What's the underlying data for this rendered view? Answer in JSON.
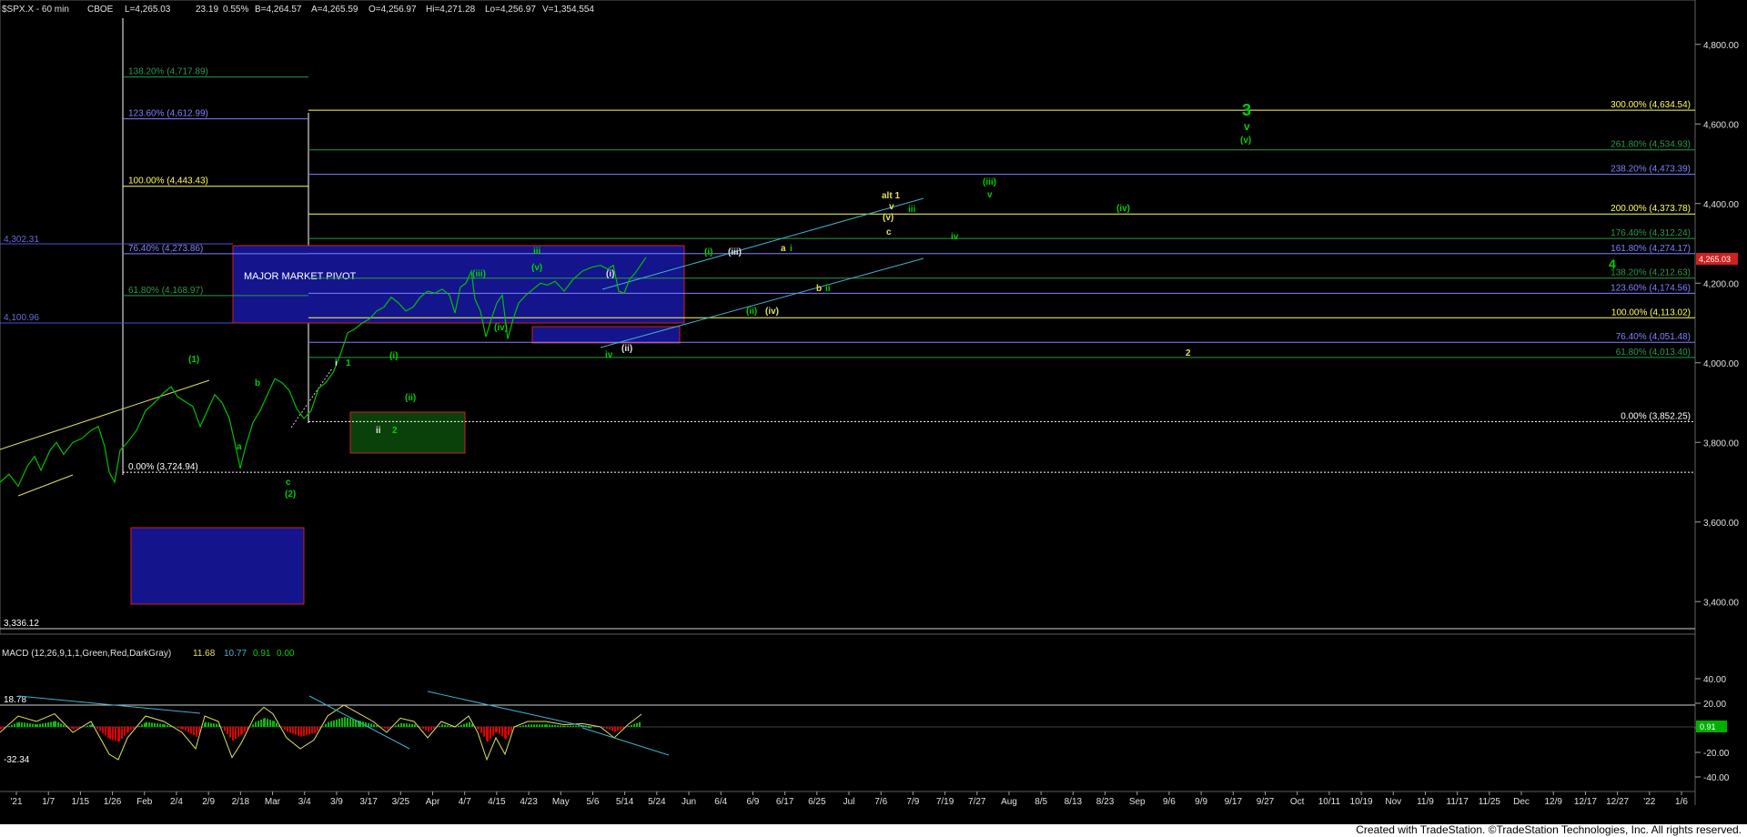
{
  "header": {
    "symbol": "$SPX.X - 60 min",
    "exchange": "CBOE",
    "last": "L=4,265.03",
    "change": "23.19",
    "change_pct": "0.55%",
    "bid": "B=4,264.57",
    "ask": "A=4,265.59",
    "open": "O=4,256.97",
    "high": "Hi=4,271.28",
    "low": "Lo=4,256.97",
    "volume": "V=1,354,554"
  },
  "left_labels": {
    "top_level": "4,302.31",
    "mid_level": "4,100.96",
    "bottom_level": "3,336.12"
  },
  "price_flag": "4,265.03",
  "pivot_label": "MAJOR MARKET PIVOT",
  "footer": "Created with TradeStation. ©TradeStation Technologies, Inc. All rights reserved.",
  "macd": {
    "title": "MACD (12,26,9,1,1,Green,Red,DarkGray)",
    "v1": "11.68",
    "v2": "10.77",
    "v3": "0.91",
    "v4": "0.00",
    "hi_label": "18.78",
    "lo_label": "-32.34",
    "flag": "0.91",
    "ticks": [
      "40.00",
      "20.00",
      "0.00",
      "-20.00",
      "-40.00"
    ]
  },
  "colors": {
    "background": "#000000",
    "green": "#00d000",
    "yellow": "#ffff55",
    "blue_box": "#1a1a9a",
    "cyan_line": "#40b0d0",
    "macd_pos": "#00c000",
    "macd_neg": "#e00000"
  },
  "chart_data": {
    "type": "line",
    "title": "$SPX.X - 60 min",
    "ylim": [
      3300,
      4900
    ],
    "y_ticks": [
      "4,800.00",
      "4,600.00",
      "4,400.00",
      "4,200.00",
      "4,000.00",
      "3,800.00",
      "3,600.00",
      "3,400.00"
    ],
    "x_ticks": [
      "'21",
      "1/7",
      "1/15",
      "1/26",
      "Feb",
      "2/4",
      "2/9",
      "2/18",
      "Mar",
      "3/4",
      "3/9",
      "3/17",
      "3/25",
      "Apr",
      "4/7",
      "4/15",
      "4/23",
      "May",
      "5/6",
      "5/14",
      "5/24",
      "Jun",
      "6/4",
      "6/9",
      "6/17",
      "6/25",
      "Jul",
      "7/6",
      "7/9",
      "7/19",
      "7/27",
      "Aug",
      "8/5",
      "8/13",
      "8/23",
      "Sep",
      "9/6",
      "9/9",
      "9/17",
      "9/27",
      "Oct",
      "10/11",
      "10/19",
      "Nov",
      "11/9",
      "11/17",
      "11/25",
      "Dec",
      "12/9",
      "12/17",
      "12/27",
      "'22",
      "1/6"
    ],
    "fib_right": [
      {
        "label": "300.00% (4,634.54)",
        "value": 4634.54,
        "color": "#ffff55"
      },
      {
        "label": "261.80% (4,534.93)",
        "value": 4534.93,
        "color": "#2a9a4a"
      },
      {
        "label": "238.20% (4,473.39)",
        "value": 4473.39,
        "color": "#8080ff"
      },
      {
        "label": "200.00% (4,373.78)",
        "value": 4373.78,
        "color": "#ffff55"
      },
      {
        "label": "176.40% (4,312.24)",
        "value": 4312.24,
        "color": "#2a9a4a"
      },
      {
        "label": "161.80% (4,274.17)",
        "value": 4274.17,
        "color": "#8080ff"
      },
      {
        "label": "138.20% (4,212.63)",
        "value": 4212.63,
        "color": "#2a9a4a"
      },
      {
        "label": "123.60% (4,174.56)",
        "value": 4174.56,
        "color": "#8080ff"
      },
      {
        "label": "100.00% (4,113.02)",
        "value": 4113.02,
        "color": "#ffff55"
      },
      {
        "label": "76.40% (4,051.48)",
        "value": 4051.48,
        "color": "#8080ff"
      },
      {
        "label": "61.80% (4,013.40)",
        "value": 4013.4,
        "color": "#2a9a4a"
      },
      {
        "label": "0.00% (3,852.25)",
        "value": 3852.25,
        "color": "#ffffff"
      }
    ],
    "fib_left": [
      {
        "label": "138.20% (4,717.89)",
        "value": 4717.89,
        "color": "#2a9a4a"
      },
      {
        "label": "123.60% (4,612.99)",
        "value": 4612.99,
        "color": "#8080ff"
      },
      {
        "label": "100.00% (4,443.43)",
        "value": 4443.43,
        "color": "#ffff55"
      },
      {
        "label": "76.40% (4,273.86)",
        "value": 4273.86,
        "color": "#8080ff"
      },
      {
        "label": "61.80% (4,168.97)",
        "value": 4168.97,
        "color": "#2a9a4a"
      },
      {
        "label": "0.00% (3,724.94)",
        "value": 3724.94,
        "color": "#ffffff"
      }
    ],
    "price_path": [
      [
        0,
        3700
      ],
      [
        10,
        3720
      ],
      [
        20,
        3690
      ],
      [
        30,
        3740
      ],
      [
        38,
        3765
      ],
      [
        45,
        3730
      ],
      [
        55,
        3780
      ],
      [
        62,
        3800
      ],
      [
        70,
        3770
      ],
      [
        80,
        3800
      ],
      [
        90,
        3810
      ],
      [
        100,
        3830
      ],
      [
        108,
        3840
      ],
      [
        115,
        3790
      ],
      [
        120,
        3725
      ],
      [
        126,
        3700
      ],
      [
        132,
        3780
      ],
      [
        140,
        3800
      ],
      [
        150,
        3830
      ],
      [
        160,
        3880
      ],
      [
        170,
        3900
      ],
      [
        180,
        3925
      ],
      [
        188,
        3940
      ],
      [
        195,
        3915
      ],
      [
        205,
        3900
      ],
      [
        212,
        3890
      ],
      [
        220,
        3840
      ],
      [
        228,
        3880
      ],
      [
        236,
        3920
      ],
      [
        244,
        3900
      ],
      [
        252,
        3860
      ],
      [
        258,
        3800
      ],
      [
        264,
        3735
      ],
      [
        270,
        3790
      ],
      [
        278,
        3850
      ],
      [
        286,
        3880
      ],
      [
        294,
        3920
      ],
      [
        302,
        3960
      ],
      [
        310,
        3950
      ],
      [
        318,
        3930
      ],
      [
        326,
        3885
      ],
      [
        334,
        3860
      ],
      [
        342,
        3880
      ],
      [
        350,
        3935
      ],
      [
        358,
        3950
      ],
      [
        366,
        3975
      ],
      [
        374,
        4020
      ],
      [
        382,
        4075
      ],
      [
        390,
        4085
      ],
      [
        398,
        4100
      ],
      [
        406,
        4110
      ],
      [
        414,
        4130
      ],
      [
        422,
        4140
      ],
      [
        430,
        4165
      ],
      [
        438,
        4150
      ],
      [
        446,
        4130
      ],
      [
        454,
        4140
      ],
      [
        462,
        4165
      ],
      [
        470,
        4180
      ],
      [
        478,
        4175
      ],
      [
        486,
        4185
      ],
      [
        494,
        4170
      ],
      [
        500,
        4125
      ],
      [
        506,
        4190
      ],
      [
        512,
        4200
      ],
      [
        518,
        4230
      ],
      [
        522,
        4160
      ],
      [
        528,
        4130
      ],
      [
        534,
        4065
      ],
      [
        540,
        4110
      ],
      [
        546,
        4150
      ],
      [
        552,
        4170
      ],
      [
        558,
        4060
      ],
      [
        564,
        4110
      ],
      [
        570,
        4150
      ],
      [
        578,
        4170
      ],
      [
        586,
        4185
      ],
      [
        594,
        4200
      ],
      [
        602,
        4195
      ],
      [
        610,
        4205
      ],
      [
        620,
        4180
      ],
      [
        630,
        4210
      ],
      [
        640,
        4230
      ],
      [
        650,
        4240
      ],
      [
        660,
        4245
      ],
      [
        668,
        4235
      ],
      [
        674,
        4245
      ],
      [
        680,
        4180
      ],
      [
        686,
        4175
      ],
      [
        692,
        4210
      ],
      [
        698,
        4225
      ],
      [
        704,
        4245
      ],
      [
        710,
        4265
      ]
    ],
    "macd_line": [
      [
        0,
        -5
      ],
      [
        20,
        10
      ],
      [
        40,
        5
      ],
      [
        60,
        12
      ],
      [
        80,
        -5
      ],
      [
        100,
        5
      ],
      [
        120,
        -25
      ],
      [
        130,
        -30
      ],
      [
        140,
        -10
      ],
      [
        160,
        10
      ],
      [
        180,
        5
      ],
      [
        200,
        -5
      ],
      [
        215,
        -20
      ],
      [
        225,
        10
      ],
      [
        240,
        5
      ],
      [
        255,
        -28
      ],
      [
        265,
        -15
      ],
      [
        280,
        10
      ],
      [
        290,
        18
      ],
      [
        300,
        12
      ],
      [
        315,
        -10
      ],
      [
        330,
        -20
      ],
      [
        345,
        -12
      ],
      [
        360,
        10
      ],
      [
        378,
        20
      ],
      [
        395,
        12
      ],
      [
        410,
        5
      ],
      [
        425,
        -5
      ],
      [
        440,
        8
      ],
      [
        455,
        5
      ],
      [
        470,
        -10
      ],
      [
        485,
        5
      ],
      [
        500,
        0
      ],
      [
        515,
        10
      ],
      [
        525,
        -5
      ],
      [
        535,
        -30
      ],
      [
        545,
        -10
      ],
      [
        555,
        -25
      ],
      [
        565,
        0
      ],
      [
        580,
        5
      ],
      [
        600,
        5
      ],
      [
        620,
        2
      ],
      [
        640,
        3
      ],
      [
        660,
        0
      ],
      [
        675,
        -10
      ],
      [
        690,
        2
      ],
      [
        705,
        11.68
      ]
    ]
  }
}
